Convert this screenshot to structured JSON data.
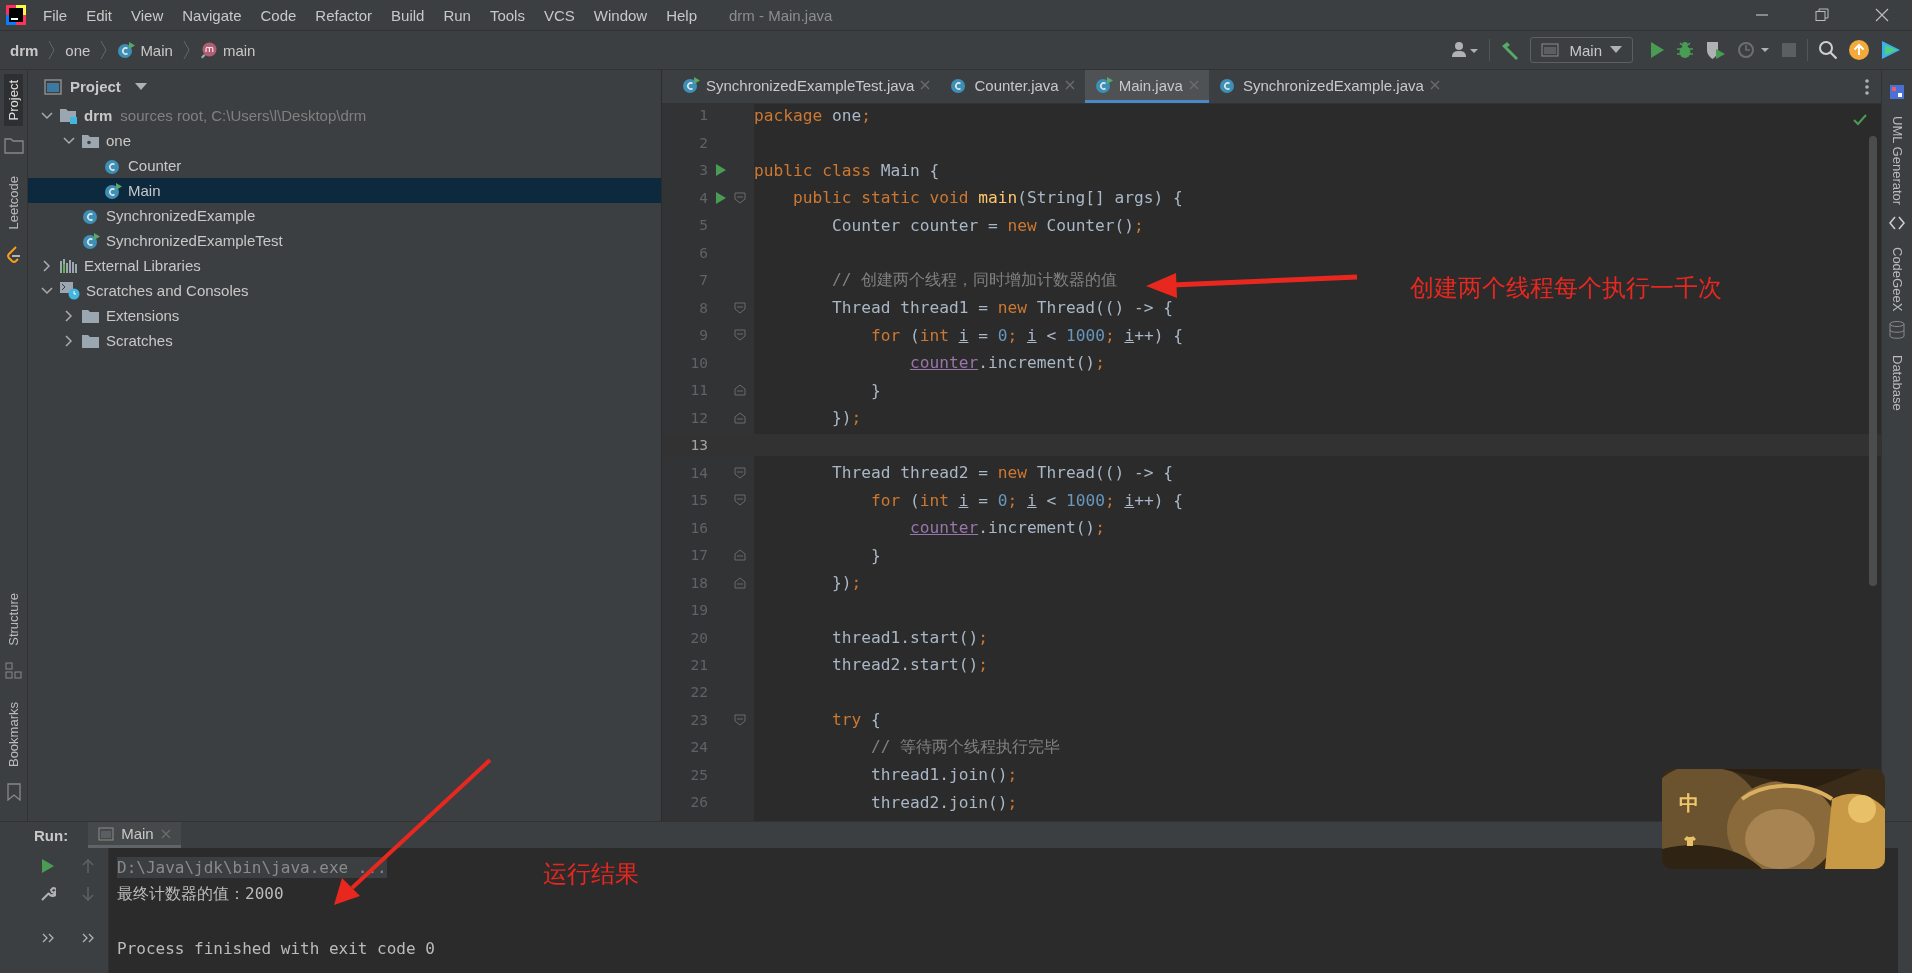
{
  "menu_bar": {
    "items": [
      "File",
      "Edit",
      "View",
      "Navigate",
      "Code",
      "Refactor",
      "Build",
      "Run",
      "Tools",
      "VCS",
      "Window",
      "Help"
    ],
    "title": "drm - Main.java"
  },
  "breadcrumbs": [
    {
      "label": "drm",
      "kind": "module"
    },
    {
      "label": "one",
      "kind": "package"
    },
    {
      "label": "Main",
      "kind": "class-run"
    },
    {
      "label": "main",
      "kind": "method"
    }
  ],
  "toolbar": {
    "run_config": "Main"
  },
  "left_strip": {
    "top": [
      {
        "label": "Project",
        "selected": true
      },
      {
        "label": "Leetcode",
        "selected": false
      }
    ],
    "bottom": [
      {
        "label": "Structure",
        "selected": false
      },
      {
        "label": "Bookmarks",
        "selected": false
      }
    ]
  },
  "right_strip": [
    {
      "label": "UML Generator"
    },
    {
      "label": "CodeGeeX"
    },
    {
      "label": "Database"
    }
  ],
  "project": {
    "title": "Project",
    "tree": [
      {
        "label": "drm",
        "note": "sources root,  C:\\Users\\l\\Desktop\\drm",
        "kind": "module",
        "expanded": true,
        "selected": false,
        "children": [
          {
            "label": "one",
            "kind": "package",
            "expanded": true,
            "selected": false,
            "children": [
              {
                "label": "Counter",
                "kind": "class",
                "selected": false
              },
              {
                "label": "Main",
                "kind": "class-run",
                "selected": true
              }
            ]
          },
          {
            "label": "SynchronizedExample",
            "kind": "class",
            "selected": false
          },
          {
            "label": "SynchronizedExampleTest",
            "kind": "class-run",
            "selected": false
          }
        ]
      },
      {
        "label": "External Libraries",
        "kind": "libraries",
        "expanded": false,
        "selected": false
      },
      {
        "label": "Scratches and Consoles",
        "kind": "scratches",
        "expanded": true,
        "selected": false,
        "children": [
          {
            "label": "Extensions",
            "kind": "folder",
            "expanded": false,
            "selected": false
          },
          {
            "label": "Scratches",
            "kind": "folder",
            "expanded": false,
            "selected": false
          }
        ]
      }
    ]
  },
  "editor": {
    "tabs": [
      {
        "label": "SynchronizedExampleTest.java",
        "kind": "class-run",
        "selected": false
      },
      {
        "label": "Counter.java",
        "kind": "class",
        "selected": false
      },
      {
        "label": "Main.java",
        "kind": "class-run",
        "selected": true
      },
      {
        "label": "SynchronizedExample.java",
        "kind": "class",
        "selected": false
      }
    ],
    "lines": [
      {
        "number": "1",
        "run_marker": false,
        "fold_start": false,
        "fold_end": false,
        "current": false,
        "tokens": [
          {
            "kind": "keyword",
            "text": "package "
          },
          {
            "kind": "plain",
            "text": "one"
          },
          {
            "kind": "punct",
            "text": ";"
          }
        ]
      },
      {
        "number": "2",
        "run_marker": false,
        "fold_start": false,
        "fold_end": false,
        "current": false
      },
      {
        "number": "3",
        "run_marker": true,
        "fold_start": false,
        "fold_end": false,
        "current": false,
        "tokens": [
          {
            "kind": "keyword",
            "text": "public class "
          },
          {
            "kind": "plain",
            "text": "Main {"
          }
        ]
      },
      {
        "number": "4",
        "run_marker": true,
        "fold_start": true,
        "fold_end": false,
        "current": false,
        "tokens": [
          {
            "kind": "keyword",
            "text": "    public static void "
          },
          {
            "kind": "method",
            "text": "main"
          },
          {
            "kind": "plain",
            "text": "(String[] args) {"
          }
        ]
      },
      {
        "number": "5",
        "run_marker": false,
        "fold_start": false,
        "fold_end": false,
        "current": false,
        "tokens": [
          {
            "kind": "plain",
            "text": "        Counter counter = "
          },
          {
            "kind": "keyword",
            "text": "new "
          },
          {
            "kind": "plain",
            "text": "Counter()"
          },
          {
            "kind": "punct",
            "text": ";"
          }
        ]
      },
      {
        "number": "6",
        "run_marker": false,
        "fold_start": false,
        "fold_end": false,
        "current": false
      },
      {
        "number": "7",
        "run_marker": false,
        "fold_start": false,
        "fold_end": false,
        "current": false,
        "tokens": [
          {
            "kind": "comment",
            "text": "        // 创建两个线程，同时增加计数器的值"
          }
        ]
      },
      {
        "number": "8",
        "run_marker": false,
        "fold_start": true,
        "fold_end": false,
        "current": false,
        "tokens": [
          {
            "kind": "plain",
            "text": "        Thread thread1 = "
          },
          {
            "kind": "keyword",
            "text": "new "
          },
          {
            "kind": "plain",
            "text": "Thread(() -> {"
          }
        ]
      },
      {
        "number": "9",
        "run_marker": false,
        "fold_start": true,
        "fold_end": false,
        "current": false,
        "tokens": [
          {
            "kind": "keyword",
            "text": "            for "
          },
          {
            "kind": "plain",
            "text": "("
          },
          {
            "kind": "keyword",
            "text": "int "
          },
          {
            "kind": "var",
            "text": "i"
          },
          {
            "kind": "plain",
            "text": " = "
          },
          {
            "kind": "number",
            "text": "0"
          },
          {
            "kind": "punct",
            "text": "; "
          },
          {
            "kind": "var",
            "text": "i"
          },
          {
            "kind": "plain",
            "text": " < "
          },
          {
            "kind": "number",
            "text": "1000"
          },
          {
            "kind": "punct",
            "text": "; "
          },
          {
            "kind": "var",
            "text": "i"
          },
          {
            "kind": "plain",
            "text": "++) {"
          }
        ]
      },
      {
        "number": "10",
        "run_marker": false,
        "fold_start": false,
        "fold_end": false,
        "current": false,
        "tokens": [
          {
            "kind": "field",
            "text": "                counter"
          },
          {
            "kind": "plain",
            "text": ".increment()"
          },
          {
            "kind": "punct",
            "text": ";"
          }
        ]
      },
      {
        "number": "11",
        "run_marker": false,
        "fold_start": false,
        "fold_end": true,
        "current": false,
        "tokens": [
          {
            "kind": "plain",
            "text": "            }"
          }
        ]
      },
      {
        "number": "12",
        "run_marker": false,
        "fold_start": false,
        "fold_end": true,
        "current": false,
        "tokens": [
          {
            "kind": "plain",
            "text": "        })"
          },
          {
            "kind": "punct",
            "text": ";"
          }
        ]
      },
      {
        "number": "13",
        "run_marker": false,
        "fold_start": false,
        "fold_end": false,
        "current": true
      },
      {
        "number": "14",
        "run_marker": false,
        "fold_start": true,
        "fold_end": false,
        "current": false,
        "tokens": [
          {
            "kind": "plain",
            "text": "        Thread thread2 = "
          },
          {
            "kind": "keyword",
            "text": "new "
          },
          {
            "kind": "plain",
            "text": "Thread(() -> {"
          }
        ]
      },
      {
        "number": "15",
        "run_marker": false,
        "fold_start": true,
        "fold_end": false,
        "current": false,
        "tokens": [
          {
            "kind": "keyword",
            "text": "            for "
          },
          {
            "kind": "plain",
            "text": "("
          },
          {
            "kind": "keyword",
            "text": "int "
          },
          {
            "kind": "var",
            "text": "i"
          },
          {
            "kind": "plain",
            "text": " = "
          },
          {
            "kind": "number",
            "text": "0"
          },
          {
            "kind": "punct",
            "text": "; "
          },
          {
            "kind": "var",
            "text": "i"
          },
          {
            "kind": "plain",
            "text": " < "
          },
          {
            "kind": "number",
            "text": "1000"
          },
          {
            "kind": "punct",
            "text": "; "
          },
          {
            "kind": "var",
            "text": "i"
          },
          {
            "kind": "plain",
            "text": "++) {"
          }
        ]
      },
      {
        "number": "16",
        "run_marker": false,
        "fold_start": false,
        "fold_end": false,
        "current": false,
        "tokens": [
          {
            "kind": "field",
            "text": "                counter"
          },
          {
            "kind": "plain",
            "text": ".increment()"
          },
          {
            "kind": "punct",
            "text": ";"
          }
        ]
      },
      {
        "number": "17",
        "run_marker": false,
        "fold_start": false,
        "fold_end": true,
        "current": false,
        "tokens": [
          {
            "kind": "plain",
            "text": "            }"
          }
        ]
      },
      {
        "number": "18",
        "run_marker": false,
        "fold_start": false,
        "fold_end": true,
        "current": false,
        "tokens": [
          {
            "kind": "plain",
            "text": "        })"
          },
          {
            "kind": "punct",
            "text": ";"
          }
        ]
      },
      {
        "number": "19",
        "run_marker": false,
        "fold_start": false,
        "fold_end": false,
        "current": false
      },
      {
        "number": "20",
        "run_marker": false,
        "fold_start": false,
        "fold_end": false,
        "current": false,
        "tokens": [
          {
            "kind": "plain",
            "text": "        thread1.start()"
          },
          {
            "kind": "punct",
            "text": ";"
          }
        ]
      },
      {
        "number": "21",
        "run_marker": false,
        "fold_start": false,
        "fold_end": false,
        "current": false,
        "tokens": [
          {
            "kind": "plain",
            "text": "        thread2.start()"
          },
          {
            "kind": "punct",
            "text": ";"
          }
        ]
      },
      {
        "number": "22",
        "run_marker": false,
        "fold_start": false,
        "fold_end": false,
        "current": false
      },
      {
        "number": "23",
        "run_marker": false,
        "fold_start": true,
        "fold_end": false,
        "current": false,
        "tokens": [
          {
            "kind": "keyword",
            "text": "        try "
          },
          {
            "kind": "plain",
            "text": "{"
          }
        ]
      },
      {
        "number": "24",
        "run_marker": false,
        "fold_start": false,
        "fold_end": false,
        "current": false,
        "tokens": [
          {
            "kind": "comment",
            "text": "            // 等待两个线程执行完毕"
          }
        ]
      },
      {
        "number": "25",
        "run_marker": false,
        "fold_start": false,
        "fold_end": false,
        "current": false,
        "tokens": [
          {
            "kind": "plain",
            "text": "            thread1.join()"
          },
          {
            "kind": "punct",
            "text": ";"
          }
        ]
      },
      {
        "number": "26",
        "run_marker": false,
        "fold_start": false,
        "fold_end": false,
        "current": false,
        "tokens": [
          {
            "kind": "plain",
            "text": "            thread2.join()"
          },
          {
            "kind": "punct",
            "text": ";"
          }
        ]
      }
    ]
  },
  "run_panel": {
    "label": "Run:",
    "tab": "Main",
    "output": [
      {
        "kind": "command",
        "text": "D:\\Java\\jdk\\bin\\java.exe ..."
      },
      {
        "kind": "stdout",
        "text": "最终计数器的值：2000"
      },
      {
        "kind": "blank"
      },
      {
        "kind": "stdout",
        "text": "Process finished with exit code 0"
      }
    ]
  },
  "assistant_widget": {
    "kind": "picture",
    "label": "中"
  },
  "annotations": [
    {
      "text": "创建两个线程每个执行一千次"
    },
    {
      "text": "运行结果"
    }
  ]
}
